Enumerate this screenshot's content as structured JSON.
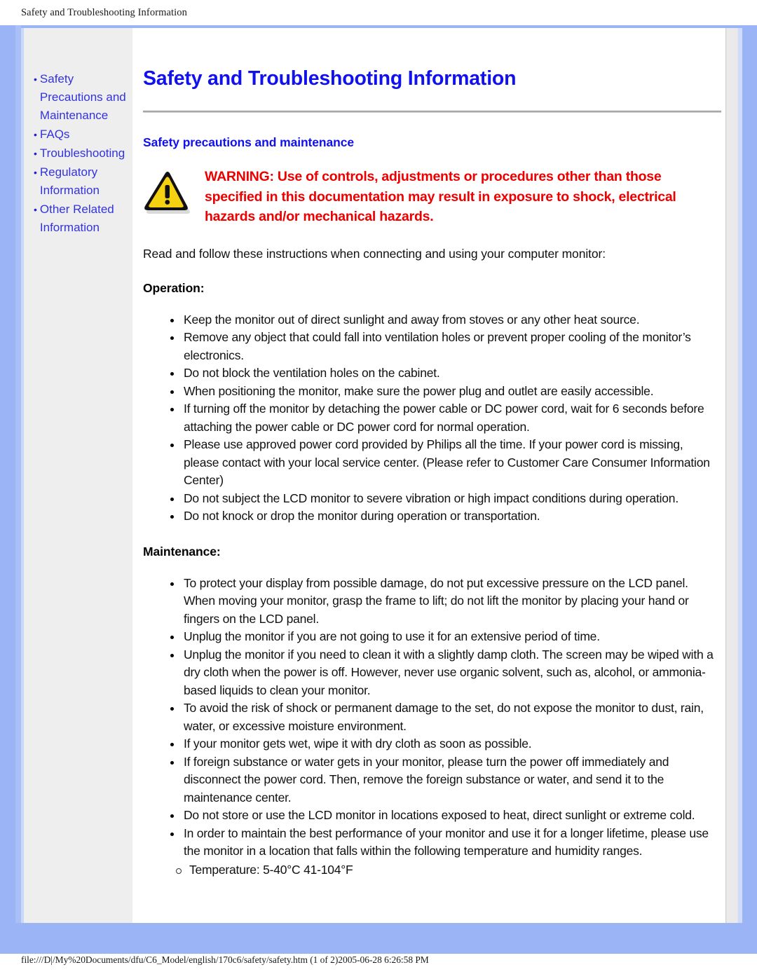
{
  "print_header": {
    "text": "Safety and Troubleshooting Information"
  },
  "print_footer": {
    "text": "file:///D|/My%20Documents/dfu/C6_Model/english/170c6/safety/safety.htm (1 of 2)2005-06-28 6:26:58 PM"
  },
  "colors": {
    "frame_blue": "#9ab4f5",
    "sidebar_gray": "#eeeeee",
    "link_blue": "#3333dd",
    "title_blue": "#1111ee",
    "warning_red": "#ee0000",
    "warning_icon_yellow": "#f5d211"
  },
  "sidebar": {
    "items": [
      {
        "label": "Safety Precautions and Maintenance",
        "bullet": "•"
      },
      {
        "label": "FAQs",
        "bullet": "•"
      },
      {
        "label": "Troubleshooting",
        "bullet": "•"
      },
      {
        "label": "Regulatory Information",
        "bullet": "•"
      },
      {
        "label": "Other Related Information",
        "bullet": "•"
      }
    ]
  },
  "main": {
    "title": "Safety and Troubleshooting Information",
    "subtitle": "Safety precautions and maintenance",
    "warning_icon_name": "warning-triangle-icon",
    "warning_text": "WARNING: Use of controls, adjustments or procedures other than those specified in this documentation may result in exposure to shock, electrical hazards and/or mechanical hazards.",
    "intro": "Read and follow these instructions when connecting and using your computer monitor:",
    "operation_heading": "Operation:",
    "operation_items": [
      "Keep the monitor out of direct sunlight and away from stoves or any other heat source.",
      "Remove any object that could fall into ventilation holes or prevent proper cooling of the monitor’s electronics.",
      "Do not block the ventilation holes on the cabinet.",
      "When positioning the monitor, make sure the power plug and outlet are easily accessible.",
      "If turning off the monitor by detaching the power cable or DC power cord, wait for 6 seconds before attaching the power cable or DC power cord for normal operation.",
      "Please use approved power cord provided by Philips all the time. If your power cord is missing, please contact with your local service center. (Please refer to Customer Care Consumer Information Center)",
      "Do not subject the LCD monitor to severe vibration or high impact conditions during operation.",
      "Do not knock or drop the monitor during operation or transportation."
    ],
    "maintenance_heading": "Maintenance:",
    "maintenance_items": [
      "To protect your display from possible damage, do not put excessive pressure on the LCD panel. When moving your monitor, grasp the frame to lift; do not lift the monitor by placing your hand or fingers on the LCD panel.",
      "Unplug the monitor if you are not going to use it for an extensive period of time.",
      "Unplug the monitor if you need to clean it with a slightly damp cloth. The screen may be wiped with a dry cloth when the power is off. However, never use organic solvent, such as, alcohol, or ammonia-based liquids to clean your monitor.",
      "To avoid the risk of shock or permanent damage to the set, do not expose the monitor to dust, rain, water, or excessive moisture environment.",
      "If your monitor gets wet, wipe it with dry cloth as soon as possible.",
      "If foreign substance or water gets in your monitor, please turn the power off immediately and disconnect the power cord. Then, remove the foreign substance or water, and send it to the maintenance center.",
      "Do not store or use the LCD monitor in locations exposed to heat, direct sunlight or extreme cold.",
      "In order to maintain the best performance of your monitor and use it for a longer lifetime, please use the monitor in a location that falls within the following temperature and humidity ranges."
    ],
    "maintenance_subitems": [
      "Temperature: 5-40°C 41-104°F"
    ]
  }
}
